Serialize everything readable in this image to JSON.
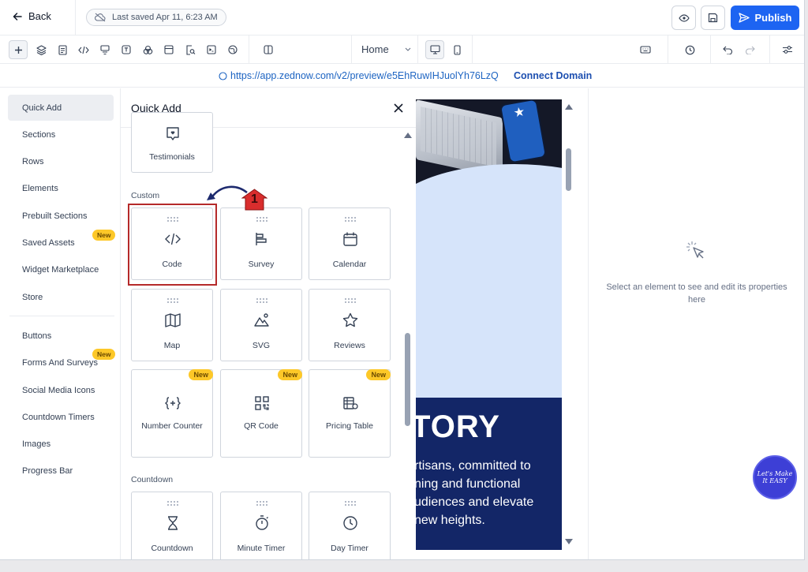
{
  "header": {
    "back_label": "Back",
    "saved_text": "Last saved Apr 11, 6:23 AM",
    "publish_label": "Publish"
  },
  "toolbar": {
    "page_select": "Home"
  },
  "urlbar": {
    "url": "https://app.zednow.com/v2/preview/e5EhRuwIHJuolYh76LzQ",
    "connect_label": "Connect Domain"
  },
  "leftnav": {
    "items": [
      {
        "label": "Quick Add"
      },
      {
        "label": "Sections"
      },
      {
        "label": "Rows"
      },
      {
        "label": "Elements"
      },
      {
        "label": "Prebuilt Sections"
      },
      {
        "label": "Saved Assets",
        "badge": "New"
      },
      {
        "label": "Widget Marketplace"
      },
      {
        "label": "Store"
      },
      {
        "label": "Buttons"
      },
      {
        "label": "Forms And Surveys",
        "badge": "New"
      },
      {
        "label": "Social Media Icons"
      },
      {
        "label": "Countdown Timers"
      },
      {
        "label": "Images"
      },
      {
        "label": "Progress Bar"
      }
    ]
  },
  "panel": {
    "title": "Quick Add",
    "testimonials_label": "Testimonials",
    "custom_label": "Custom",
    "countdown_label": "Countdown",
    "custom_cards": [
      {
        "label": "Code",
        "icon": "code-icon"
      },
      {
        "label": "Survey",
        "icon": "survey-icon"
      },
      {
        "label": "Calendar",
        "icon": "calendar-icon"
      },
      {
        "label": "Map",
        "icon": "map-icon"
      },
      {
        "label": "SVG",
        "icon": "svg-icon"
      },
      {
        "label": "Reviews",
        "icon": "star-icon"
      },
      {
        "label": "Number Counter",
        "icon": "number-counter-icon",
        "badge": "New"
      },
      {
        "label": "QR Code",
        "icon": "qr-code-icon",
        "badge": "New"
      },
      {
        "label": "Pricing Table",
        "icon": "pricing-table-icon",
        "badge": "New"
      }
    ],
    "countdown_cards": [
      {
        "label": "Countdown",
        "icon": "hourglass-icon"
      },
      {
        "label": "Minute Timer",
        "icon": "stopwatch-icon"
      },
      {
        "label": "Day Timer",
        "icon": "clock-icon"
      }
    ]
  },
  "annotation": {
    "step": "1"
  },
  "preview": {
    "heading": "TORY",
    "body_lines": [
      "rtisans, committed to",
      "ning and functional",
      "udiences and elevate",
      "new heights."
    ]
  },
  "props": {
    "empty_text": "Select an element to see and edit its properties here"
  },
  "watermark": {
    "text": "Let's Make It EASY"
  }
}
